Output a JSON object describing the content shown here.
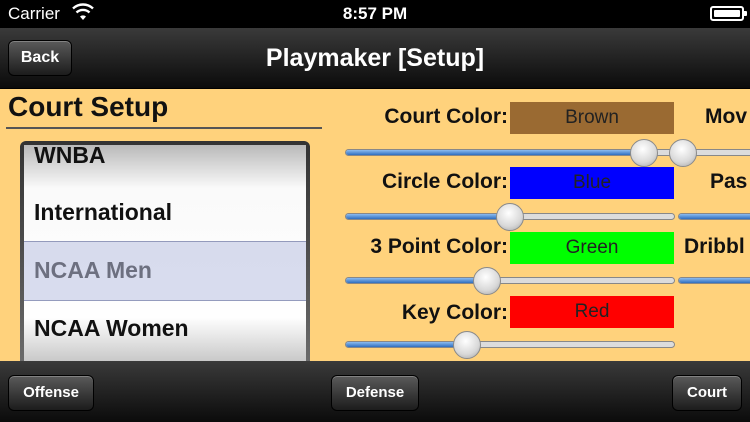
{
  "status_bar": {
    "carrier": "Carrier",
    "time": "8:57 PM"
  },
  "nav": {
    "back_label": "Back",
    "title": "Playmaker [Setup]"
  },
  "court_setup": {
    "header": "Court Setup",
    "picker_items": [
      "WNBA",
      "International",
      "NCAA Men",
      "NCAA Women"
    ],
    "selected": "NCAA Men"
  },
  "colors": [
    {
      "label": "Court Color:",
      "value": "Brown",
      "swatch": "#9a6a32",
      "slider": 0.91
    },
    {
      "label": "Circle Color:",
      "value": "Blue",
      "swatch": "#0000ff",
      "slider": 0.5
    },
    {
      "label": "3 Point Color:",
      "value": "Green",
      "swatch": "#00ff00",
      "slider": 0.43
    },
    {
      "label": "Key Color:",
      "value": "Red",
      "swatch": "#ff0000",
      "slider": 0.37
    }
  ],
  "right_column": [
    {
      "label": "Mov",
      "slider": 0.05
    },
    {
      "label": "Pas",
      "slider": 0.0
    },
    {
      "label": "Dribbl",
      "slider": 0.0
    }
  ],
  "toolbar": {
    "offense_label": "Offense",
    "defense_label": "Defense",
    "court_label": "Court"
  }
}
